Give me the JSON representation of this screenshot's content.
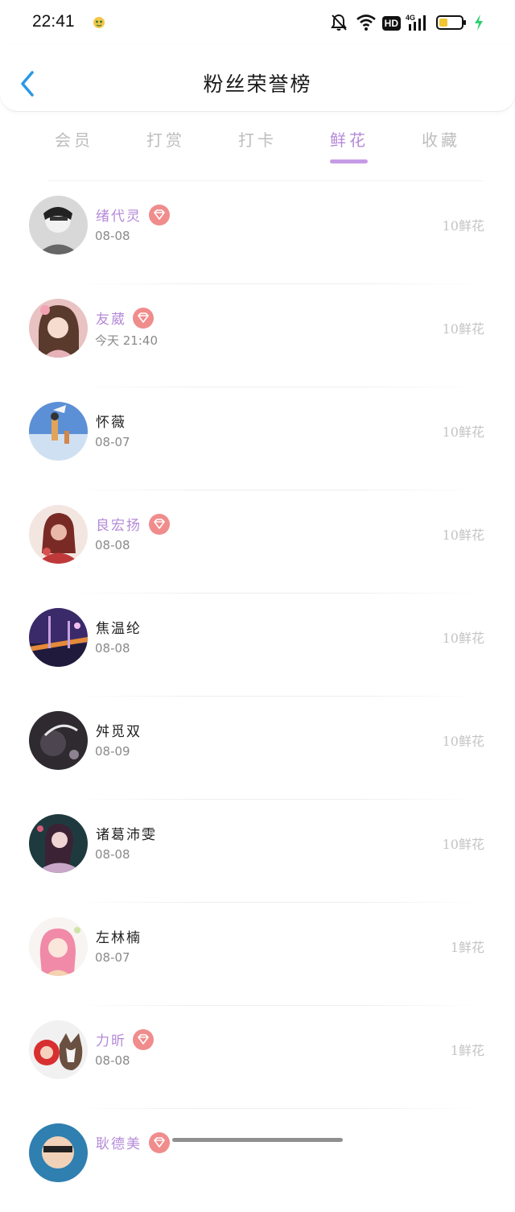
{
  "status_bar": {
    "time": "22:41",
    "network": "4G",
    "hd_label": "HD"
  },
  "header": {
    "title": "粉丝荣誉榜",
    "back_icon": "chevron-left-icon",
    "accent_color": "#2a98e6"
  },
  "tabs": [
    {
      "label": "会员",
      "active": false
    },
    {
      "label": "打赏",
      "active": false
    },
    {
      "label": "打卡",
      "active": false
    },
    {
      "label": "鲜花",
      "active": true
    },
    {
      "label": "收藏",
      "active": false
    }
  ],
  "colors": {
    "active_tab": "#b48ad8",
    "vip_name": "#b48ad8",
    "vip_badge": "#f08c8c",
    "inactive_text": "#bdbdbd"
  },
  "rows": [
    {
      "name": "绪代灵",
      "vip": true,
      "date": "08-08",
      "amount": "10鲜花"
    },
    {
      "name": "友葳",
      "vip": true,
      "date": "今天 21:40",
      "amount": "10鲜花"
    },
    {
      "name": "怀薇",
      "vip": false,
      "date": "08-07",
      "amount": "10鲜花"
    },
    {
      "name": "良宏扬",
      "vip": true,
      "date": "08-08",
      "amount": "10鲜花"
    },
    {
      "name": "焦温纶",
      "vip": false,
      "date": "08-08",
      "amount": "10鲜花"
    },
    {
      "name": "舛觅双",
      "vip": false,
      "date": "08-09",
      "amount": "10鲜花"
    },
    {
      "name": "诸葛沛雯",
      "vip": false,
      "date": "08-08",
      "amount": "10鲜花"
    },
    {
      "name": "左林楠",
      "vip": false,
      "date": "08-07",
      "amount": "1鲜花"
    },
    {
      "name": "力昕",
      "vip": true,
      "date": "08-08",
      "amount": "1鲜花"
    },
    {
      "name": "耿德美",
      "vip": true,
      "date": "",
      "amount": ""
    }
  ]
}
